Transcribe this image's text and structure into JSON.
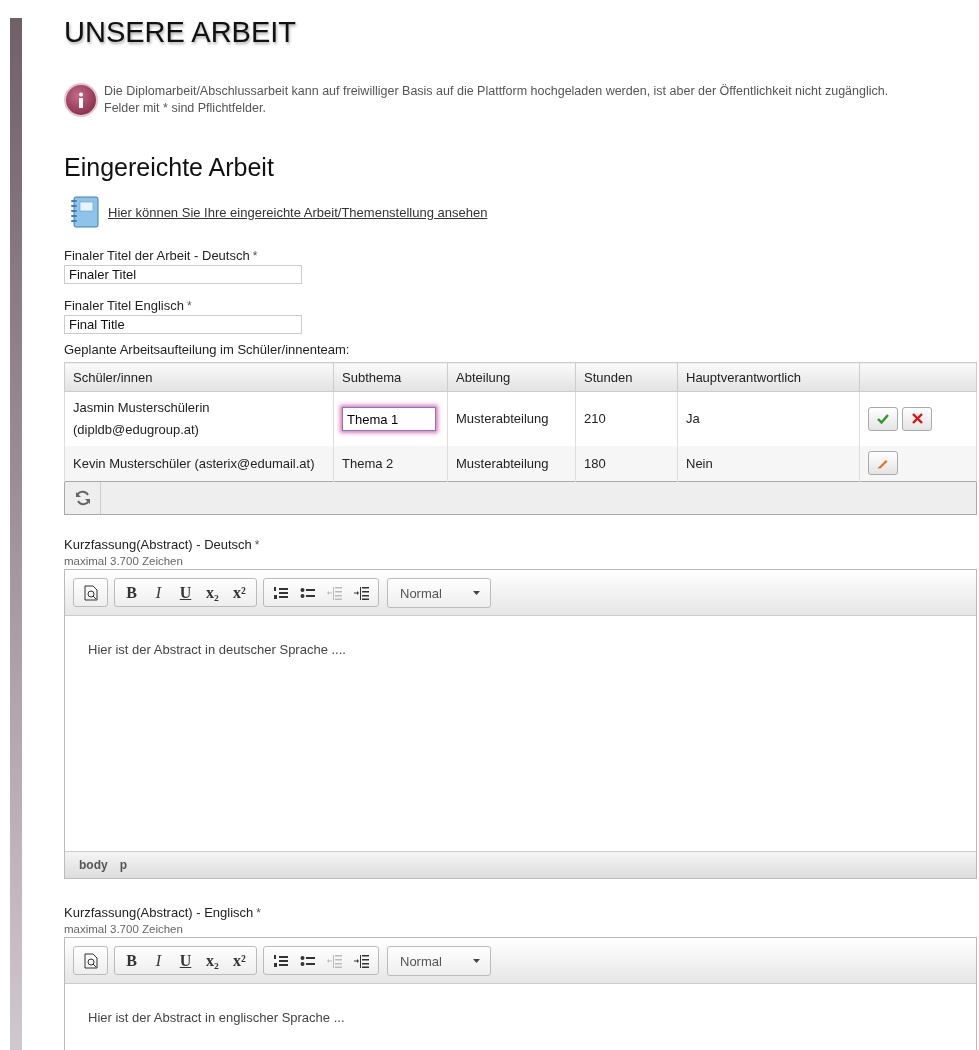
{
  "title": "UNSERE ARBEIT",
  "info": {
    "lines": [
      "Die Diplomarbeit/Abschlussarbeit kann auf freiwilliger Basis auf die Plattform hochgeladen werden, ist aber der Öffentlichkeit nicht zugänglich.",
      "Felder mit * sind Pflichtfelder."
    ]
  },
  "section_title": "Eingereichte Arbeit",
  "document_link": "Hier können Sie Ihre eingereichte Arbeit/Themenstellung ansehen",
  "fields": [
    {
      "label": "Finaler Titel der Arbeit - Deutsch",
      "required_mark": "*",
      "value": "Finaler Titel"
    },
    {
      "label": "Finaler Titel Englisch",
      "required_mark": "*",
      "value": "Final Title"
    }
  ],
  "team": {
    "caption": "Geplante Arbeitsaufteilung im Schüler/innenteam:",
    "columns": [
      "Schüler/innen",
      "Subthema",
      "Abteilung",
      "Stunden",
      "Hauptverantwortlich"
    ],
    "rows": [
      {
        "editing": true,
        "cells": [
          "Jasmin Musterschülerin (dipldb@edugroup.at)",
          "Thema 1",
          "Musterabteilung",
          "210",
          "Ja"
        ]
      },
      {
        "editing": false,
        "cells": [
          "Kevin Musterschüler (asterix@edumail.at)",
          "Thema 2",
          "Musterabteilung",
          "180",
          "Nein"
        ]
      }
    ]
  },
  "editors": [
    {
      "label": "Kurzfassung(Abstract) - Deutsch",
      "required_mark": "*",
      "hint": "maximal 3.700 Zeichen",
      "toolbar": [
        [
          {
            "kind": "preview",
            "disabled": false
          }
        ],
        [
          {
            "kind": "bold",
            "label": "B",
            "disabled": false
          },
          {
            "kind": "italic",
            "label": "I",
            "disabled": false
          },
          {
            "kind": "underline",
            "label": "U",
            "disabled": false
          },
          {
            "kind": "subscript",
            "label": "x₂",
            "disabled": false
          },
          {
            "kind": "superscript",
            "label": "x²",
            "disabled": false
          }
        ],
        [
          {
            "kind": "ordered-list",
            "disabled": false
          },
          {
            "kind": "bullet-list",
            "disabled": false
          },
          {
            "kind": "outdent",
            "disabled": true
          },
          {
            "kind": "indent",
            "disabled": false
          }
        ]
      ],
      "format": "Normal",
      "text": "Hier ist der Abstract in deutscher Sprache ....",
      "path": [
        "body",
        "p"
      ]
    },
    {
      "label": "Kurzfassung(Abstract) - Englisch",
      "required_mark": "*",
      "hint": "maximal 3.700 Zeichen",
      "toolbar": [
        [
          {
            "kind": "preview",
            "disabled": false
          }
        ],
        [
          {
            "kind": "bold",
            "label": "B",
            "disabled": false
          },
          {
            "kind": "italic",
            "label": "I",
            "disabled": false
          },
          {
            "kind": "underline",
            "label": "U",
            "disabled": false
          },
          {
            "kind": "subscript",
            "label": "x₂",
            "disabled": false
          },
          {
            "kind": "superscript",
            "label": "x²",
            "disabled": false
          }
        ],
        [
          {
            "kind": "ordered-list",
            "disabled": false
          },
          {
            "kind": "bullet-list",
            "disabled": false
          },
          {
            "kind": "outdent",
            "disabled": true
          },
          {
            "kind": "indent",
            "disabled": false
          }
        ]
      ],
      "format": "Normal",
      "text": "Hier ist der Abstract in englischer Sprache ..."
    }
  ]
}
